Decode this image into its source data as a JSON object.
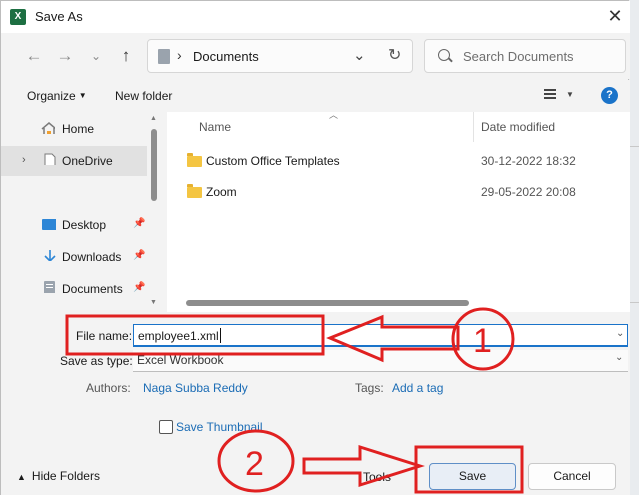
{
  "window": {
    "title": "Save As",
    "app_icon_letter": "X",
    "close_glyph": "✕"
  },
  "nav": {
    "back_icon": "arrow-left-icon",
    "forward_icon": "arrow-right-icon",
    "recent_icon": "chevron-down-icon",
    "up_icon": "arrow-up-icon",
    "address_path": "Documents",
    "search_placeholder": "Search Documents"
  },
  "commands": {
    "organize": "Organize",
    "new_folder": "New folder",
    "help": "?"
  },
  "sidebar": {
    "items": [
      {
        "label": "Home",
        "icon": "home-icon"
      },
      {
        "label": "OneDrive",
        "icon": "document-icon"
      },
      {
        "label": "Desktop",
        "icon": "desktop-icon"
      },
      {
        "label": "Downloads",
        "icon": "download-icon"
      },
      {
        "label": "Documents",
        "icon": "documents-icon"
      }
    ]
  },
  "filelist": {
    "columns": [
      "Name",
      "Date modified"
    ],
    "rows": [
      {
        "name": "Custom Office Templates",
        "date": "30-12-2022 18:32"
      },
      {
        "name": "Zoom",
        "date": "29-05-2022 20:08"
      }
    ]
  },
  "form": {
    "file_name_label": "File name:",
    "file_name_value": "employee1.xml",
    "save_type_label": "Save as type:",
    "save_type_value": "Excel Workbook",
    "authors_label": "Authors:",
    "authors_value": "Naga Subba Reddy",
    "tags_label": "Tags:",
    "tags_value": "Add a tag",
    "thumbnail_label": "Save Thumbnail"
  },
  "footer": {
    "hide_folders": "Hide Folders",
    "tools": "Tools",
    "save": "Save",
    "cancel": "Cancel"
  },
  "annotations": {
    "step1": "1",
    "step2": "2",
    "color": "#e02020"
  }
}
